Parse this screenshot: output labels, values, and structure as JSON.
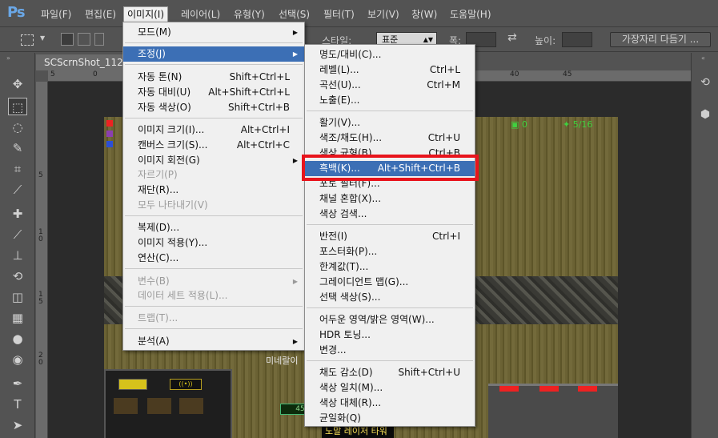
{
  "app": {
    "logo": "Ps"
  },
  "menubar": {
    "items": [
      {
        "label": "파일(F)"
      },
      {
        "label": "편집(E)"
      },
      {
        "label": "이미지(I)"
      },
      {
        "label": "레이어(L)"
      },
      {
        "label": "유형(Y)"
      },
      {
        "label": "선택(S)"
      },
      {
        "label": "필터(T)"
      },
      {
        "label": "보기(V)"
      },
      {
        "label": "창(W)"
      },
      {
        "label": "도움말(H)"
      }
    ]
  },
  "options": {
    "style_label": "스타일:",
    "style_value": "표준",
    "width_label": "폭:",
    "height_label": "높이:",
    "refine_edge_button": "가장자리 다듬기 ..."
  },
  "document": {
    "tab_title": "SCScrnShot_11251",
    "ruler_h": [
      "5",
      "0",
      "5",
      "10",
      "15",
      "20",
      "25",
      "30",
      "35",
      "40",
      "45"
    ],
    "ruler_v": [
      "5",
      "1\n0",
      "1\n5",
      "2\n0"
    ]
  },
  "game": {
    "res_minerals": "0",
    "res_supply": "5/16",
    "label_mineral": "미네랄이",
    "status_value": "45",
    "bottom_label": "노말 레이저 타워",
    "hud_badge": "((•))"
  },
  "image_menu": {
    "items": [
      {
        "label": "모드(M)",
        "shortcut": "",
        "submenu": true,
        "disabled": false
      },
      {
        "label": "조정(J)",
        "shortcut": "",
        "submenu": true,
        "disabled": false,
        "highlighted": true
      },
      {
        "label": "자동 톤(N)",
        "shortcut": "Shift+Ctrl+L",
        "submenu": false,
        "disabled": false
      },
      {
        "label": "자동 대비(U)",
        "shortcut": "Alt+Shift+Ctrl+L",
        "submenu": false,
        "disabled": false
      },
      {
        "label": "자동 색상(O)",
        "shortcut": "Shift+Ctrl+B",
        "submenu": false,
        "disabled": false
      },
      {
        "label": "이미지 크기(I)...",
        "shortcut": "Alt+Ctrl+I",
        "submenu": false,
        "disabled": false
      },
      {
        "label": "캔버스 크기(S)...",
        "shortcut": "Alt+Ctrl+C",
        "submenu": false,
        "disabled": false
      },
      {
        "label": "이미지 회전(G)",
        "shortcut": "",
        "submenu": true,
        "disabled": false
      },
      {
        "label": "자르기(P)",
        "shortcut": "",
        "submenu": false,
        "disabled": true
      },
      {
        "label": "재단(R)...",
        "shortcut": "",
        "submenu": false,
        "disabled": false
      },
      {
        "label": "모두 나타내기(V)",
        "shortcut": "",
        "submenu": false,
        "disabled": true
      },
      {
        "label": "복제(D)...",
        "shortcut": "",
        "submenu": false,
        "disabled": false
      },
      {
        "label": "이미지 적용(Y)...",
        "shortcut": "",
        "submenu": false,
        "disabled": false
      },
      {
        "label": "연산(C)...",
        "shortcut": "",
        "submenu": false,
        "disabled": false
      },
      {
        "label": "변수(B)",
        "shortcut": "",
        "submenu": true,
        "disabled": true
      },
      {
        "label": "데이터 세트 적용(L)...",
        "shortcut": "",
        "submenu": false,
        "disabled": true
      },
      {
        "label": "트랩(T)...",
        "shortcut": "",
        "submenu": false,
        "disabled": true
      },
      {
        "label": "분석(A)",
        "shortcut": "",
        "submenu": true,
        "disabled": false
      }
    ]
  },
  "adjust_menu": {
    "items": [
      {
        "label": "명도/대비(C)...",
        "shortcut": ""
      },
      {
        "label": "레벨(L)...",
        "shortcut": "Ctrl+L"
      },
      {
        "label": "곡선(U)...",
        "shortcut": "Ctrl+M"
      },
      {
        "label": "노출(E)...",
        "shortcut": ""
      },
      {
        "label": "활기(V)...",
        "shortcut": ""
      },
      {
        "label": "색조/채도(H)...",
        "shortcut": "Ctrl+U"
      },
      {
        "label": "색상 균형(B)...",
        "shortcut": "Ctrl+B"
      },
      {
        "label": "흑백(K)...",
        "shortcut": "Alt+Shift+Ctrl+B",
        "highlighted": true
      },
      {
        "label": "포토 필터(F)...",
        "shortcut": ""
      },
      {
        "label": "채널 혼합(X)...",
        "shortcut": ""
      },
      {
        "label": "색상 검색...",
        "shortcut": ""
      },
      {
        "label": "반전(I)",
        "shortcut": "Ctrl+I"
      },
      {
        "label": "포스터화(P)...",
        "shortcut": ""
      },
      {
        "label": "한계값(T)...",
        "shortcut": ""
      },
      {
        "label": "그레이디언트 맵(G)...",
        "shortcut": ""
      },
      {
        "label": "선택 색상(S)...",
        "shortcut": ""
      },
      {
        "label": "어두운 영역/밝은 영역(W)...",
        "shortcut": ""
      },
      {
        "label": "HDR 토닝...",
        "shortcut": ""
      },
      {
        "label": "변경...",
        "shortcut": ""
      },
      {
        "label": "채도 감소(D)",
        "shortcut": "Shift+Ctrl+U"
      },
      {
        "label": "색상 일치(M)...",
        "shortcut": ""
      },
      {
        "label": "색상 대체(R)...",
        "shortcut": ""
      },
      {
        "label": "균일화(Q)",
        "shortcut": ""
      }
    ]
  },
  "colors": {
    "menu_highlight": "#3c6fb5",
    "annotation_red": "#e8141c",
    "app_bg": "#535353"
  }
}
